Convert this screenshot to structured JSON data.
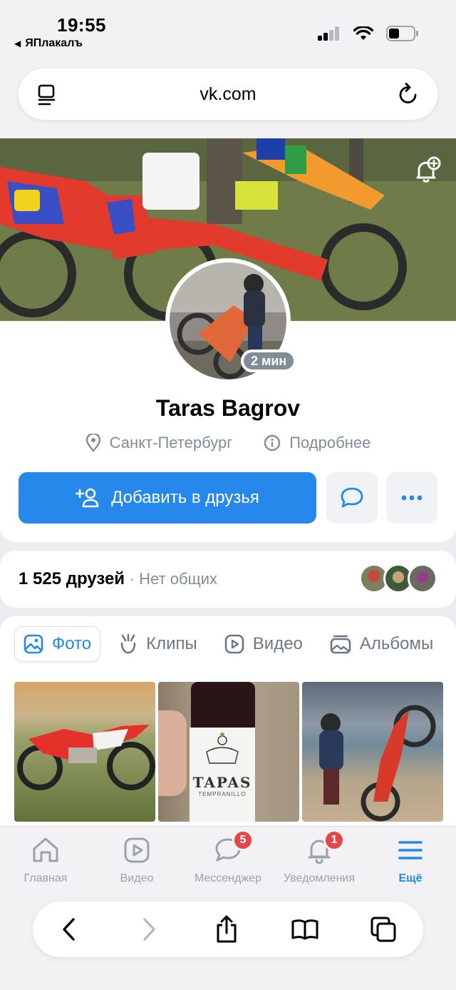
{
  "status_bar": {
    "time": "19:55",
    "back_app": "ЯПлакалъ"
  },
  "browser": {
    "url": "vk.com"
  },
  "profile": {
    "name": "Taras Bagrov",
    "last_seen": "2 мин",
    "city": "Санкт-Петербург",
    "details_link": "Подробнее",
    "add_friend_label": "Добавить в друзья"
  },
  "friends": {
    "count": "1 525 друзей",
    "mutual": "· Нет общих"
  },
  "media_tabs": [
    {
      "label": "Фото",
      "active": true
    },
    {
      "label": "Клипы",
      "active": false
    },
    {
      "label": "Видео",
      "active": false
    },
    {
      "label": "Альбомы",
      "active": false
    }
  ],
  "photos": {
    "bottle_label_main": "TAPAS",
    "bottle_label_sub": "TEMPRANILLO"
  },
  "tabbar": [
    {
      "label": "Главная",
      "icon": "home-icon",
      "badge": ""
    },
    {
      "label": "Видео",
      "icon": "video-icon",
      "badge": ""
    },
    {
      "label": "Мессенджер",
      "icon": "messenger-icon",
      "badge": "5"
    },
    {
      "label": "Уведомления",
      "icon": "bell-icon",
      "badge": "1"
    },
    {
      "label": "Ещё",
      "icon": "menu-icon",
      "badge": ""
    }
  ],
  "colors": {
    "accent": "#2688eb",
    "secondary_text": "#818c99",
    "badge": "#e64646"
  }
}
